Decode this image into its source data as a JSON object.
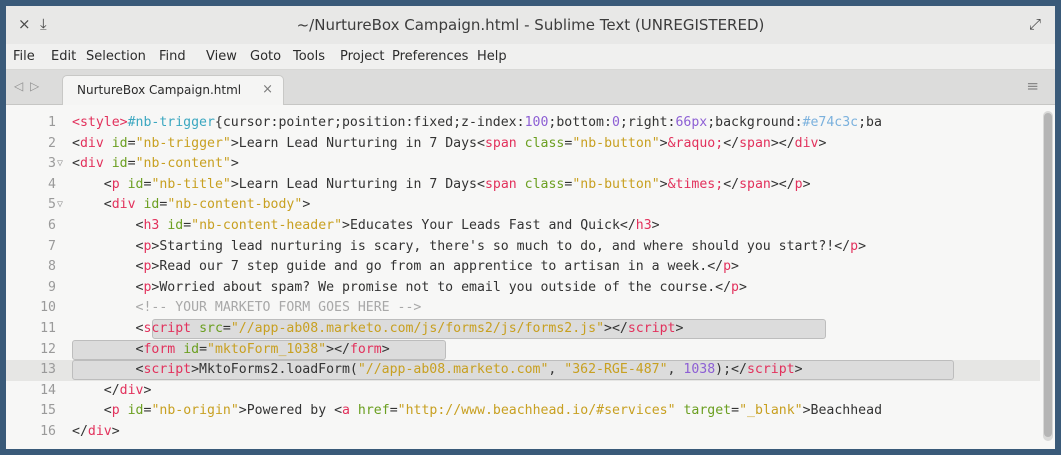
{
  "window": {
    "title": "~/NurtureBox Campaign.html - Sublime Text (UNREGISTERED)",
    "close_glyph": "×",
    "pin_glyph": "⤓",
    "maximize_glyph": "⤢"
  },
  "menu": [
    "File",
    "Edit",
    "Selection",
    "Find",
    "View",
    "Goto",
    "Tools",
    "Project",
    "Preferences",
    "Help"
  ],
  "tabs": {
    "nav_left": "◁",
    "nav_right": "▷",
    "active_label": "NurtureBox Campaign.html",
    "close_glyph": "×",
    "menu_glyph": "≡"
  },
  "editor": {
    "fold_glyph": "▽",
    "current_line": 13,
    "lines": [
      {
        "n": "1",
        "folded": false,
        "segments": [
          [
            "t",
            "<style>"
          ],
          [
            "k",
            "#nb-trigger"
          ],
          [
            "p",
            "{cursor:pointer;position:fixed;z-index:"
          ],
          [
            "n",
            "100"
          ],
          [
            "p",
            ";bottom:"
          ],
          [
            "n",
            "0"
          ],
          [
            "p",
            ";right:"
          ],
          [
            "n",
            "66px"
          ],
          [
            "p",
            ";background:"
          ],
          [
            "v",
            "#e74c3c"
          ],
          [
            "p",
            ";ba"
          ]
        ]
      },
      {
        "n": "2",
        "folded": false,
        "segments": [
          [
            "p",
            "<"
          ],
          [
            "t",
            "div"
          ],
          [
            "p",
            " "
          ],
          [
            "a",
            "id"
          ],
          [
            "p",
            "="
          ],
          [
            "s",
            "\"nb-trigger\""
          ],
          [
            "p",
            ">Learn Lead Nurturing in 7 Days<"
          ],
          [
            "t",
            "span"
          ],
          [
            "p",
            " "
          ],
          [
            "a",
            "class"
          ],
          [
            "p",
            "="
          ],
          [
            "s",
            "\"nb-button\""
          ],
          [
            "p",
            ">"
          ],
          [
            "t",
            "&raquo;"
          ],
          [
            "p",
            "</"
          ],
          [
            "t",
            "span"
          ],
          [
            "p",
            "></"
          ],
          [
            "t",
            "div"
          ],
          [
            "p",
            ">"
          ]
        ]
      },
      {
        "n": "3",
        "folded": true,
        "segments": [
          [
            "p",
            "<"
          ],
          [
            "t",
            "div"
          ],
          [
            "p",
            " "
          ],
          [
            "a",
            "id"
          ],
          [
            "p",
            "="
          ],
          [
            "s",
            "\"nb-content\""
          ],
          [
            "p",
            ">"
          ]
        ]
      },
      {
        "n": "4",
        "folded": false,
        "segments": [
          [
            "p",
            "    <"
          ],
          [
            "t",
            "p"
          ],
          [
            "p",
            " "
          ],
          [
            "a",
            "id"
          ],
          [
            "p",
            "="
          ],
          [
            "s",
            "\"nb-title\""
          ],
          [
            "p",
            ">Learn Lead Nurturing in 7 Days<"
          ],
          [
            "t",
            "span"
          ],
          [
            "p",
            " "
          ],
          [
            "a",
            "class"
          ],
          [
            "p",
            "="
          ],
          [
            "s",
            "\"nb-button\""
          ],
          [
            "p",
            ">"
          ],
          [
            "t",
            "&times;"
          ],
          [
            "p",
            "</"
          ],
          [
            "t",
            "span"
          ],
          [
            "p",
            "></"
          ],
          [
            "t",
            "p"
          ],
          [
            "p",
            ">"
          ]
        ]
      },
      {
        "n": "5",
        "folded": true,
        "segments": [
          [
            "p",
            "    <"
          ],
          [
            "t",
            "div"
          ],
          [
            "p",
            " "
          ],
          [
            "a",
            "id"
          ],
          [
            "p",
            "="
          ],
          [
            "s",
            "\"nb-content-body\""
          ],
          [
            "p",
            ">"
          ]
        ]
      },
      {
        "n": "6",
        "folded": false,
        "segments": [
          [
            "p",
            "        <"
          ],
          [
            "t",
            "h3"
          ],
          [
            "p",
            " "
          ],
          [
            "a",
            "id"
          ],
          [
            "p",
            "="
          ],
          [
            "s",
            "\"nb-content-header\""
          ],
          [
            "p",
            ">Educates Your Leads Fast and Quick</"
          ],
          [
            "t",
            "h3"
          ],
          [
            "p",
            ">"
          ]
        ]
      },
      {
        "n": "7",
        "folded": false,
        "segments": [
          [
            "p",
            "        <"
          ],
          [
            "t",
            "p"
          ],
          [
            "p",
            ">Starting lead nurturing is scary, there's so much to do, and where should you start?!</"
          ],
          [
            "t",
            "p"
          ],
          [
            "p",
            ">"
          ]
        ]
      },
      {
        "n": "8",
        "folded": false,
        "segments": [
          [
            "p",
            "        <"
          ],
          [
            "t",
            "p"
          ],
          [
            "p",
            ">Read our 7 step guide and go from an apprentice to artisan in a week.</"
          ],
          [
            "t",
            "p"
          ],
          [
            "p",
            ">"
          ]
        ]
      },
      {
        "n": "9",
        "folded": false,
        "segments": [
          [
            "p",
            "        <"
          ],
          [
            "t",
            "p"
          ],
          [
            "p",
            ">Worried about spam? We promise not to email you outside of the course.</"
          ],
          [
            "t",
            "p"
          ],
          [
            "p",
            ">"
          ]
        ]
      },
      {
        "n": "10",
        "folded": false,
        "segments": [
          [
            "c",
            "        <!-- YOUR MARKETO FORM GOES HERE -->"
          ]
        ]
      },
      {
        "n": "11",
        "folded": false,
        "segments": [
          [
            "p",
            "        <"
          ],
          [
            "t",
            "script"
          ],
          [
            "p",
            " "
          ],
          [
            "a",
            "src"
          ],
          [
            "p",
            "="
          ],
          [
            "s",
            "\"//app-ab08.marketo.com/js/forms2/js/forms2.js\""
          ],
          [
            "p",
            "></"
          ],
          [
            "t",
            "script"
          ],
          [
            "p",
            ">"
          ]
        ]
      },
      {
        "n": "12",
        "folded": false,
        "segments": [
          [
            "p",
            "        <"
          ],
          [
            "t",
            "form"
          ],
          [
            "p",
            " "
          ],
          [
            "a",
            "id"
          ],
          [
            "p",
            "="
          ],
          [
            "s",
            "\"mktoForm_1038\""
          ],
          [
            "p",
            "></"
          ],
          [
            "t",
            "form"
          ],
          [
            "p",
            ">"
          ]
        ]
      },
      {
        "n": "13",
        "folded": false,
        "segments": [
          [
            "p",
            "        <"
          ],
          [
            "t",
            "script"
          ],
          [
            "p",
            ">MktoForms2.loadForm("
          ],
          [
            "s",
            "\"//app-ab08.marketo.com\""
          ],
          [
            "p",
            ", "
          ],
          [
            "s",
            "\"362-RGE-487\""
          ],
          [
            "p",
            ", "
          ],
          [
            "n",
            "1038"
          ],
          [
            "p",
            ");</"
          ],
          [
            "t",
            "script"
          ],
          [
            "p",
            ">"
          ]
        ]
      },
      {
        "n": "14",
        "folded": false,
        "segments": [
          [
            "p",
            "    </"
          ],
          [
            "t",
            "div"
          ],
          [
            "p",
            ">"
          ]
        ]
      },
      {
        "n": "15",
        "folded": false,
        "segments": [
          [
            "p",
            "    <"
          ],
          [
            "t",
            "p"
          ],
          [
            "p",
            " "
          ],
          [
            "a",
            "id"
          ],
          [
            "p",
            "="
          ],
          [
            "s",
            "\"nb-origin\""
          ],
          [
            "p",
            ">Powered by <"
          ],
          [
            "t",
            "a"
          ],
          [
            "p",
            " "
          ],
          [
            "a",
            "href"
          ],
          [
            "p",
            "="
          ],
          [
            "s",
            "\"http://www.beachhead.io/#services\""
          ],
          [
            "p",
            " "
          ],
          [
            "a",
            "target"
          ],
          [
            "p",
            "="
          ],
          [
            "s",
            "\"_blank\""
          ],
          [
            "p",
            ">Beachhead"
          ]
        ]
      },
      {
        "n": "16",
        "folded": false,
        "segments": [
          [
            "p",
            "</"
          ],
          [
            "t",
            "div"
          ],
          [
            "p",
            ">"
          ]
        ]
      }
    ]
  }
}
